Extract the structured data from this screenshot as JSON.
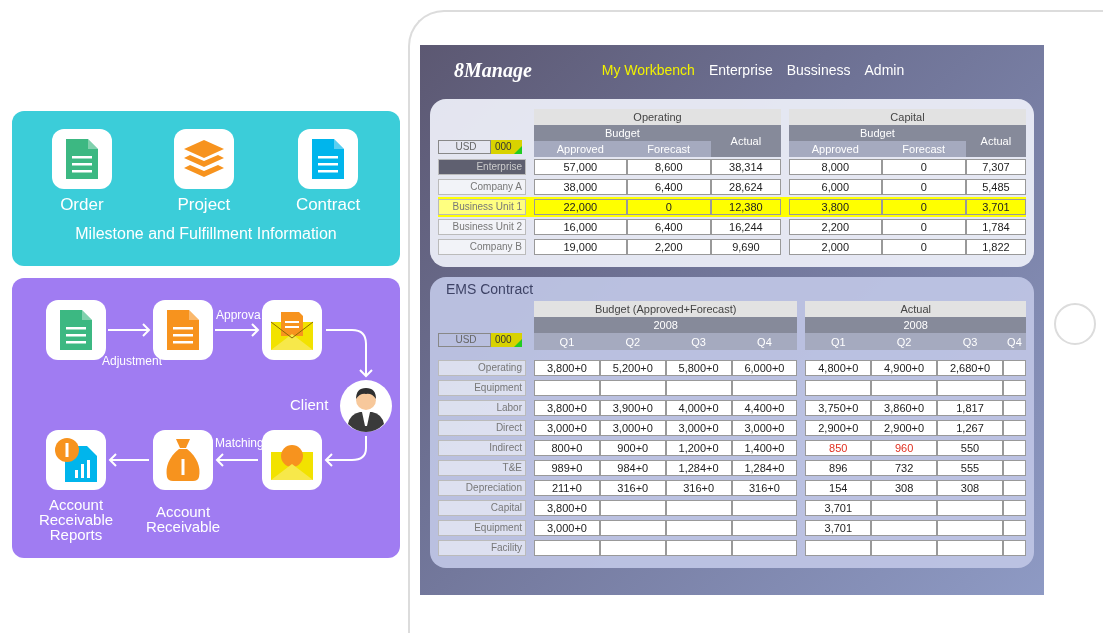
{
  "overview": {
    "items": [
      {
        "kind": "document",
        "label": "Order",
        "color": "#3cb882"
      },
      {
        "kind": "layers",
        "label": "Project",
        "color": "#f7931e"
      },
      {
        "kind": "document",
        "label": "Contract",
        "color": "#00b5ec"
      }
    ],
    "caption": "Milestone and Fulfillment Information"
  },
  "flow": {
    "nodes": [
      {
        "kind": "document",
        "color": "#3cb882"
      },
      {
        "kind": "document",
        "color": "#f7931e"
      },
      {
        "kind": "mail-document"
      },
      {
        "kind": "person",
        "label": "Client"
      },
      {
        "kind": "report",
        "label": "Account Receivable Reports"
      },
      {
        "kind": "money-bag",
        "label": "Account Receivable"
      },
      {
        "kind": "mail-coin"
      }
    ],
    "edge_labels": [
      "Adjustment",
      "Approva",
      "Matching"
    ]
  },
  "app": {
    "logo": "8Manage",
    "nav": [
      {
        "label": "My Workbench",
        "selected": true
      },
      {
        "label": "Enterprise",
        "selected": false
      },
      {
        "label": "Bussiness",
        "selected": false
      },
      {
        "label": "Admin",
        "selected": false
      }
    ],
    "summary": {
      "currency": "USD",
      "unit": "000",
      "groups": [
        {
          "title": "Operating",
          "budget": "Budget",
          "approved": "Approved",
          "forecast": "Forecast",
          "actual": "Actual"
        },
        {
          "title": "Capital",
          "budget": "Budget",
          "approved": "Approved",
          "forecast": "Forecast",
          "actual": "Actual"
        }
      ],
      "rows": [
        {
          "label": "Enterprise",
          "selected": true,
          "highlighted": false,
          "values": [
            "57,000",
            "8,600",
            "38,314",
            "8,000",
            "0",
            "7,307"
          ]
        },
        {
          "label": "Company A",
          "selected": false,
          "highlighted": false,
          "values": [
            "38,000",
            "6,400",
            "28,624",
            "6,000",
            "0",
            "5,485"
          ]
        },
        {
          "label": "Business Unit 1",
          "selected": false,
          "highlighted": true,
          "values": [
            "22,000",
            "0",
            "12,380",
            "3,800",
            "0",
            "3,701"
          ]
        },
        {
          "label": "Business Unit 2",
          "selected": false,
          "highlighted": false,
          "values": [
            "16,000",
            "6,400",
            "16,244",
            "2,200",
            "0",
            "1,784"
          ]
        },
        {
          "label": "Company B",
          "selected": false,
          "highlighted": false,
          "values": [
            "19,000",
            "2,200",
            "9,690",
            "2,000",
            "0",
            "1,822"
          ]
        }
      ]
    },
    "detail": {
      "title": "EMS Contract",
      "currency": "USD",
      "unit": "000",
      "budget_header": "Budget (Approved+Forecast)",
      "budget_year": "2008",
      "budget_quarters": [
        "Q1",
        "Q2",
        "Q3",
        "Q4"
      ],
      "actual_header": "Actual",
      "actual_year": "2008",
      "actual_quarters": [
        "Q1",
        "Q2",
        "Q3",
        "Q4"
      ],
      "rows": [
        {
          "label": "Operating",
          "budget": [
            "3,800+0",
            "5,200+0",
            "5,800+0",
            "6,000+0"
          ],
          "actual": [
            {
              "value": "4,800+0",
              "alert": false
            },
            {
              "value": "4,900+0",
              "alert": false
            },
            {
              "value": "2,680+0",
              "alert": false
            }
          ]
        },
        {
          "label": "Equipment"
        },
        {
          "label": "Labor",
          "budget": [
            "3,800+0",
            "3,900+0",
            "4,000+0",
            "4,400+0"
          ],
          "actual": [
            {
              "value": "3,750+0",
              "alert": false
            },
            {
              "value": "3,860+0",
              "alert": false
            },
            {
              "value": "1,817",
              "alert": false
            }
          ]
        },
        {
          "label": "Direct",
          "budget": [
            "3,000+0",
            "3,000+0",
            "3,000+0",
            "3,000+0"
          ],
          "actual": [
            {
              "value": "2,900+0",
              "alert": false
            },
            {
              "value": "2,900+0",
              "alert": false
            },
            {
              "value": "1,267",
              "alert": false
            }
          ]
        },
        {
          "label": "Indirect",
          "budget": [
            "800+0",
            "900+0",
            "1,200+0",
            "1,400+0"
          ],
          "actual": [
            {
              "value": "850",
              "alert": true
            },
            {
              "value": "960",
              "alert": true
            },
            {
              "value": "550",
              "alert": false
            }
          ]
        },
        {
          "label": "T&E",
          "budget": [
            "989+0",
            "984+0",
            "1,284+0",
            "1,284+0"
          ],
          "actual": [
            {
              "value": "896",
              "alert": false
            },
            {
              "value": "732",
              "alert": false
            },
            {
              "value": "555",
              "alert": false
            }
          ]
        },
        {
          "label": "Depreciation",
          "budget": [
            "211+0",
            "316+0",
            "316+0",
            "316+0"
          ],
          "actual": [
            {
              "value": "154",
              "alert": false
            },
            {
              "value": "308",
              "alert": false
            },
            {
              "value": "308",
              "alert": false
            }
          ]
        },
        {
          "label": "Capital",
          "budget": [
            "3,800+0"
          ],
          "actual": [
            {
              "value": "3,701",
              "alert": false
            }
          ]
        },
        {
          "label": "Equipment",
          "budget": [
            "3,000+0"
          ],
          "actual": [
            {
              "value": "3,701",
              "alert": false
            }
          ]
        },
        {
          "label": "Facility"
        }
      ]
    }
  }
}
